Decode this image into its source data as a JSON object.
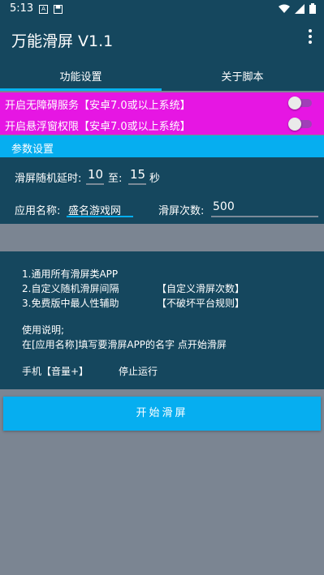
{
  "status_bar": {
    "time": "5:13",
    "icon_a": "A",
    "icon_b": "▀"
  },
  "app": {
    "title": "万能滑屏 V1.1"
  },
  "tabs": [
    {
      "label": "功能设置"
    },
    {
      "label": "关于脚本"
    }
  ],
  "permissions": [
    {
      "label": "开启无障碍服务【安卓7.0或以上系统】"
    },
    {
      "label": "开启悬浮窗权限【安卓7.0或以上系统】"
    }
  ],
  "params": {
    "header": "参数设置",
    "delay_label": "滑屏随机延时:",
    "delay_min": "10",
    "to_label": "至:",
    "delay_max": "15",
    "unit": "秒",
    "app_name_label": "应用名称:",
    "app_name_value": "盛名游戏网",
    "count_label": "滑屏次数:",
    "count_value": "500"
  },
  "info": {
    "line1": "1.通用所有滑屏类APP",
    "line2": "2.自定义随机滑屏间隔",
    "line2_right": "【自定义滑屏次数】",
    "line3": "3.免费版中最人性辅助",
    "line3_right": "【不破坏平台规则】",
    "usage_title": "使用说明;",
    "usage_text": "在[应用名称]填写要滑屏APP的名字 点开始滑屏",
    "volume_key": "手机【音量+】",
    "stop_text": "停止运行"
  },
  "start_button": "开始滑屏"
}
